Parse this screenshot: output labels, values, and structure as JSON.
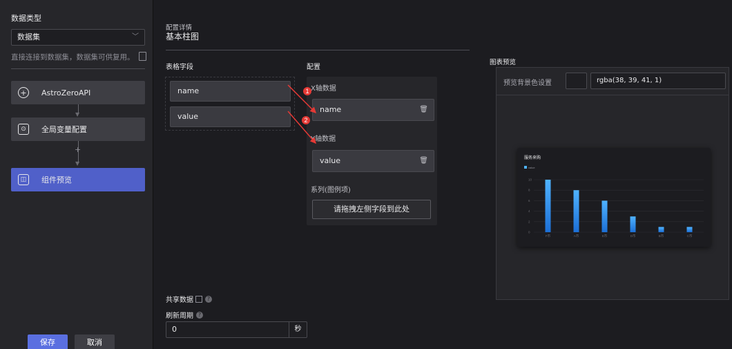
{
  "left": {
    "section_title": "数据类型",
    "select_value": "数据集",
    "hint": "直接连接到数据集，数据集可供复用。",
    "nodes": [
      {
        "label": "AstroZeroAPI",
        "icon": "plus-circle-icon"
      },
      {
        "label": "全局变量配置",
        "icon": "search-variable-icon"
      },
      {
        "label": "组件预览",
        "icon": "chart-preview-icon"
      }
    ],
    "save_label": "保存",
    "cancel_label": "取消"
  },
  "main": {
    "subtitle": "配置详情",
    "title": "基本柱图",
    "fields_label": "表格字段",
    "config_label": "配置",
    "preview_label": "图表预览",
    "fields": [
      "name",
      "value"
    ],
    "x_axis_label": "X轴数据",
    "x_axis_value": "name",
    "y_axis_label": "Y轴数据",
    "y_axis_value": "value",
    "series_label": "系列(图例项)",
    "series_placeholder": "请拖拽左侧字段到此处",
    "share_label": "共享数据",
    "refresh_label": "刷新周期",
    "refresh_value": "0",
    "refresh_unit": "秒",
    "markers": [
      "1",
      "2"
    ]
  },
  "preview": {
    "bg_label": "预览背景色设置",
    "bg_value": "rgba(38, 39, 41, 1)"
  },
  "chart_data": {
    "type": "bar",
    "title": "服务来购",
    "legend": [
      "value"
    ],
    "categories": [
      "F市",
      "A市",
      "E市",
      "D市",
      "B市",
      "C市"
    ],
    "values": [
      10,
      8,
      6,
      3,
      1,
      1
    ],
    "ylim": [
      0,
      10
    ],
    "yticks": [
      "0",
      "2",
      "4",
      "6",
      "8",
      "10"
    ],
    "colors": {
      "bar_top": "#4fb3ff",
      "bar_bottom": "#1c6fd6",
      "accent": "#5a6fe0"
    }
  }
}
